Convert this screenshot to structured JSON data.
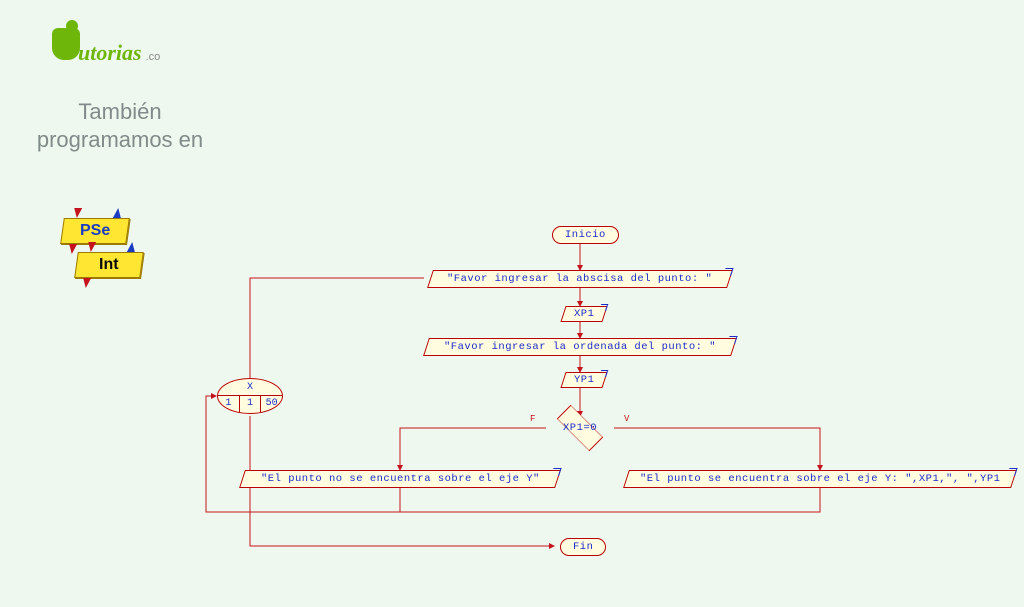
{
  "logo": {
    "text": "utorias",
    "sub": ".co"
  },
  "tagline": "También programamos en",
  "ribbons": {
    "pse": "PSe",
    "int": "Int"
  },
  "flow": {
    "start": "Inicio",
    "prompt_x": "\"Favor ingresar la abscisa del punto: \"",
    "read_x": "XP1",
    "prompt_y": "\"Favor ingresar la ordenada del punto: \"",
    "read_y": "YP1",
    "condition": "XP1=0",
    "cond_false": "F",
    "cond_true": "V",
    "out_false": "\"El punto no se encuentra sobre el eje Y\"",
    "out_true": "\"El punto se encuentra sobre el eje Y: \",XP1,\", \",YP1",
    "end": "Fin",
    "loop": {
      "var": "X",
      "from": "1",
      "step": "1",
      "to": "50"
    }
  }
}
